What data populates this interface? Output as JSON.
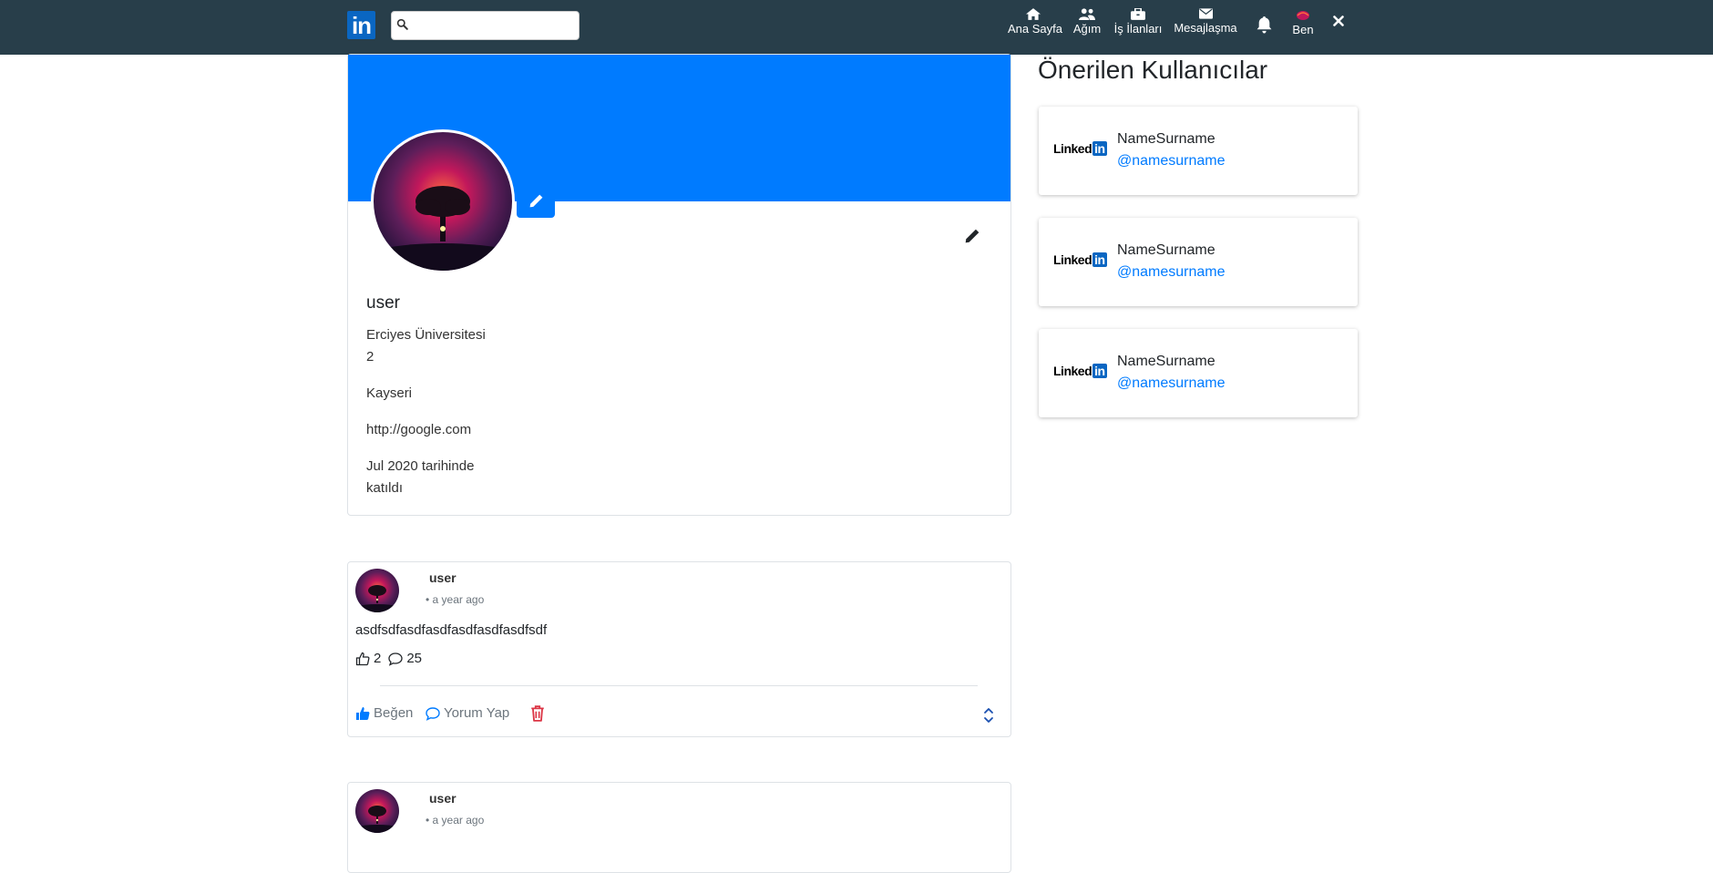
{
  "nav": {
    "logo_text": "in",
    "search_placeholder": "",
    "items": [
      {
        "label": "Ana Sayfa",
        "icon": "home-icon"
      },
      {
        "label": "Ağım",
        "icon": "users-icon"
      },
      {
        "label": "İş İlanları",
        "icon": "briefcase-icon"
      },
      {
        "label": "Mesajlaşma",
        "icon": "envelope-icon"
      },
      {
        "label": "",
        "icon": "bell-icon"
      },
      {
        "label": "Ben",
        "icon": "avatar-icon"
      },
      {
        "label": "",
        "icon": "close-icon"
      }
    ]
  },
  "profile": {
    "name": "user",
    "school": "Erciyes Üniversitesi",
    "number": "2",
    "city": "Kayseri",
    "website": "http://google.com",
    "joined_line1": "Jul 2020 tarihinde",
    "joined_line2": "katıldı"
  },
  "posts": [
    {
      "user": "user",
      "time": "• a year ago",
      "content": "asdfsdfasdfasdfasdfasdfasdfsdf",
      "likes": "2",
      "comments": "25",
      "like_label": "Beğen",
      "comment_label": "Yorum Yap"
    },
    {
      "user": "user",
      "time": "• a year ago"
    }
  ],
  "suggested": {
    "title": "Önerilen Kullanıcılar",
    "logo_text": "Linked",
    "logo_in": "in",
    "users": [
      {
        "name": "NameSurname",
        "handle": "@namesurname"
      },
      {
        "name": "NameSurname",
        "handle": "@namesurname"
      },
      {
        "name": "NameSurname",
        "handle": "@namesurname"
      }
    ]
  },
  "colors": {
    "navbar": "#283e4a",
    "cover": "#007bff",
    "accent": "#007bff",
    "danger": "#dc3545"
  }
}
